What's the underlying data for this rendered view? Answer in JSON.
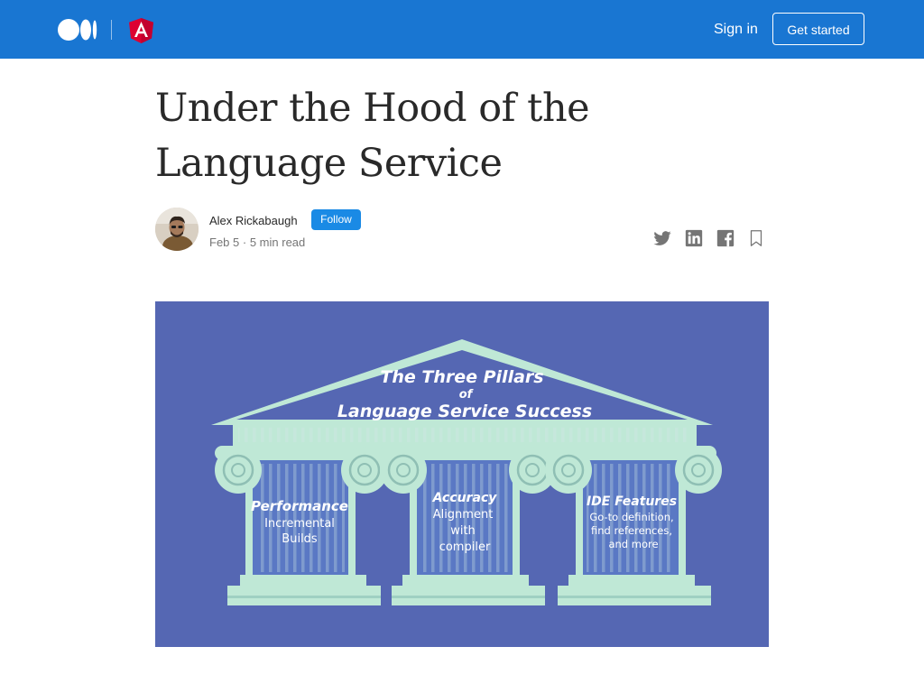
{
  "header": {
    "sign_in_label": "Sign in",
    "get_started_label": "Get started",
    "brand_color": "#1976d2"
  },
  "article": {
    "title": "Under the Hood of the Language Service",
    "author": "Alex Rickabaugh",
    "follow_label": "Follow",
    "date": "Feb 5",
    "read_time": "5 min read",
    "share_icons": [
      "twitter-icon",
      "linkedin-icon",
      "facebook-icon",
      "bookmark-icon"
    ]
  },
  "hero": {
    "title_line1": "The Three Pillars",
    "title_line2": "of",
    "title_line3": "Language Service Success",
    "pillars": [
      {
        "heading": "Performance",
        "lines": [
          "Incremental",
          "Builds"
        ]
      },
      {
        "heading": "Accuracy",
        "lines": [
          "Alignment",
          "with",
          "compiler"
        ]
      },
      {
        "heading": "IDE Features",
        "lines": [
          "Go-to definition,",
          "find references,",
          "and more"
        ]
      }
    ],
    "background_color": "#5567b3",
    "pillar_color": "#bfe8d6"
  }
}
